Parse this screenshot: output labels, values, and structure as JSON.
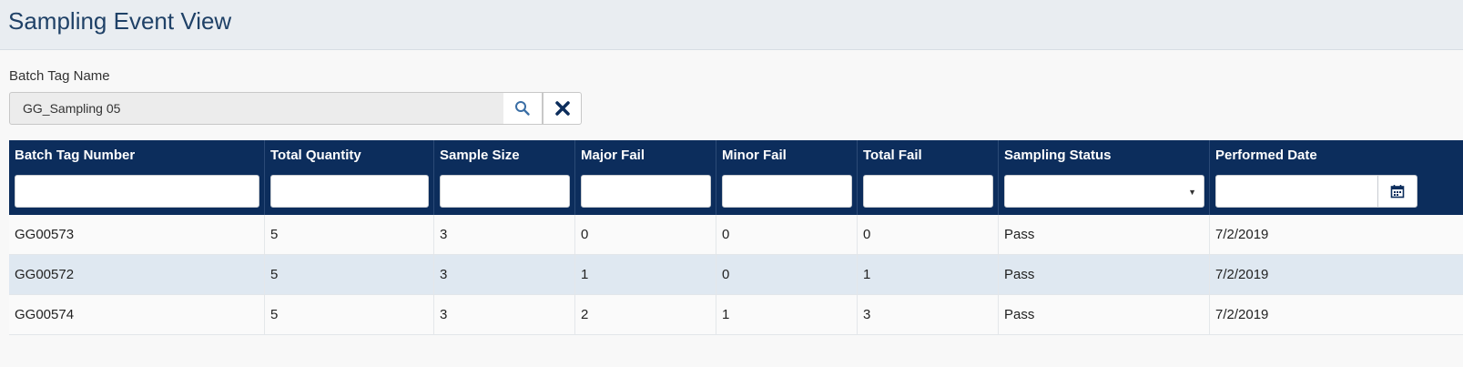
{
  "page": {
    "title": "Sampling Event View"
  },
  "search": {
    "label": "Batch Tag Name",
    "value": "GG_Sampling 05",
    "search_icon": "search-icon",
    "clear_icon": "close-icon"
  },
  "grid": {
    "columns": [
      "Batch Tag Number",
      "Total Quantity",
      "Sample Size",
      "Major Fail",
      "Minor Fail",
      "Total Fail",
      "Sampling Status",
      "Performed Date"
    ],
    "calendar_icon": "calendar-icon",
    "rows": [
      [
        "GG00573",
        "5",
        "3",
        "0",
        "0",
        "0",
        "Pass",
        "7/2/2019"
      ],
      [
        "GG00572",
        "5",
        "3",
        "1",
        "0",
        "1",
        "Pass",
        "7/2/2019"
      ],
      [
        "GG00574",
        "5",
        "3",
        "2",
        "1",
        "3",
        "Pass",
        "7/2/2019"
      ]
    ]
  },
  "colors": {
    "header_bg": "#0c2d5c",
    "title": "#1f4167",
    "alt_row": "#dfe8f1"
  }
}
